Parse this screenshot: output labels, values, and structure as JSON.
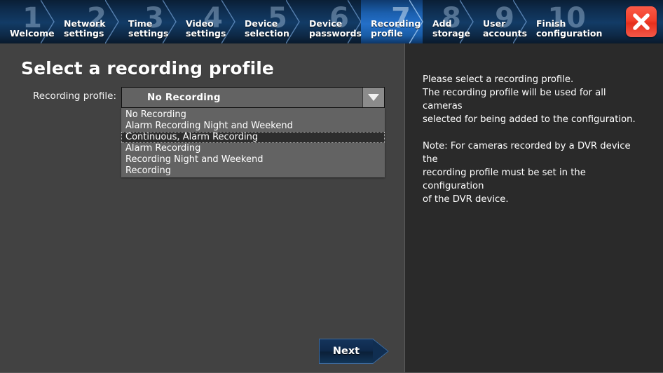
{
  "colors": {
    "nav_background": "#0e2c4d",
    "nav_active": "#2470c9",
    "left_panel": "#424242",
    "right_panel": "#2a2a2a",
    "combo_background": "#636363",
    "selected_row": "#2d2d2d",
    "close_button": "#f2402c",
    "next_button": "#102e51",
    "step_number": "#a8c3de"
  },
  "nav": {
    "steps": [
      {
        "number": "1",
        "label": "Welcome",
        "active": false
      },
      {
        "number": "2",
        "label": "Network\nsettings",
        "active": false
      },
      {
        "number": "3",
        "label": "Time\nsettings",
        "active": false
      },
      {
        "number": "4",
        "label": "Video\nsettings",
        "active": false
      },
      {
        "number": "5",
        "label": "Device\nselection",
        "active": false
      },
      {
        "number": "6",
        "label": "Device\npasswords",
        "active": false
      },
      {
        "number": "7",
        "label": "Recording\nprofile",
        "active": true
      },
      {
        "number": "8",
        "label": "Add\nstorage",
        "active": false
      },
      {
        "number": "9",
        "label": "User\naccounts",
        "active": false
      },
      {
        "number": "10",
        "label": "Finish\nconfiguration",
        "active": false
      }
    ],
    "close_icon": "close-x-icon",
    "close_tooltip": "Close"
  },
  "main": {
    "title": "Select a recording profile",
    "profile_label": "Recording profile:",
    "combo": {
      "value": "No Recording",
      "arrow_icon": "chevron-down-icon",
      "expanded": true,
      "options": [
        {
          "label": "No Recording",
          "selected": false
        },
        {
          "label": "Alarm Recording Night and Weekend",
          "selected": false
        },
        {
          "label": "Continuous, Alarm Recording",
          "selected": true
        },
        {
          "label": "Alarm Recording",
          "selected": false
        },
        {
          "label": "Recording Night and Weekend",
          "selected": false
        },
        {
          "label": "Recording",
          "selected": false
        }
      ]
    },
    "next_button": "Next"
  },
  "help": {
    "paragraph1_line1": "Please select a recording profile.",
    "paragraph1_line2": "The recording profile will be used for all cameras",
    "paragraph1_line3": "selected for being added to the configuration.",
    "paragraph2_line1": "Note: For cameras recorded by a DVR device the",
    "paragraph2_line2": "recording profile must be set in the configuration",
    "paragraph2_line3": "of the DVR device."
  }
}
